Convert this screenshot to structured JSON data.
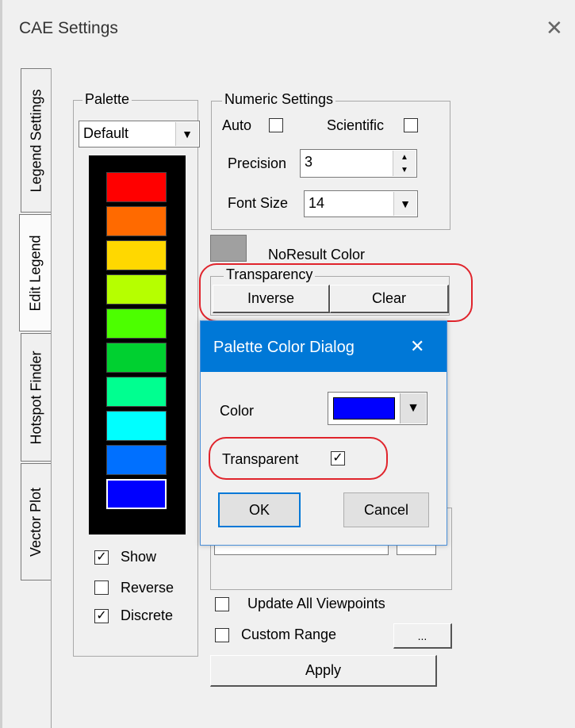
{
  "window": {
    "title": "CAE Settings"
  },
  "tabs": [
    {
      "label": "Legend Settings"
    },
    {
      "label": "Edit Legend"
    },
    {
      "label": "Hotspot Finder"
    },
    {
      "label": "Vector Plot"
    }
  ],
  "palette": {
    "group_label": "Palette",
    "selected": "Default",
    "swatches": [
      "#ff0000",
      "#ff6a00",
      "#ffd800",
      "#b6ff00",
      "#4cff00",
      "#00d030",
      "#00ff90",
      "#00ffff",
      "#0070ff",
      "#0000ff"
    ],
    "show_label": "Show",
    "show_checked": true,
    "reverse_label": "Reverse",
    "reverse_checked": false,
    "discrete_label": "Discrete",
    "discrete_checked": true
  },
  "numeric": {
    "group_label": "Numeric Settings",
    "auto_label": "Auto",
    "auto_checked": false,
    "scientific_label": "Scientific",
    "scientific_checked": false,
    "precision_label": "Precision",
    "precision_value": "3",
    "fontsize_label": "Font Size",
    "fontsize_value": "14"
  },
  "noresult": {
    "label": "NoResult Color",
    "color": "#a0a0a0"
  },
  "transparency": {
    "group_label": "Transparency",
    "inverse_label": "Inverse",
    "clear_label": "Clear"
  },
  "bottom": {
    "update_label": "Update All Viewpoints",
    "update_checked": false,
    "custom_range_label": "Custom Range",
    "custom_range_checked": false,
    "ellipsis_label": "...",
    "apply_label": "Apply"
  },
  "dialog": {
    "title": "Palette Color Dialog",
    "color_label": "Color",
    "color_value": "#0000ff",
    "transparent_label": "Transparent",
    "transparent_checked": true,
    "ok_label": "OK",
    "cancel_label": "Cancel"
  },
  "glyphs": {
    "check": "✓",
    "down": "▼",
    "up": "▲",
    "close": "✕"
  },
  "colors": {
    "accent": "#0078d7",
    "highlight": "#e0242c"
  }
}
